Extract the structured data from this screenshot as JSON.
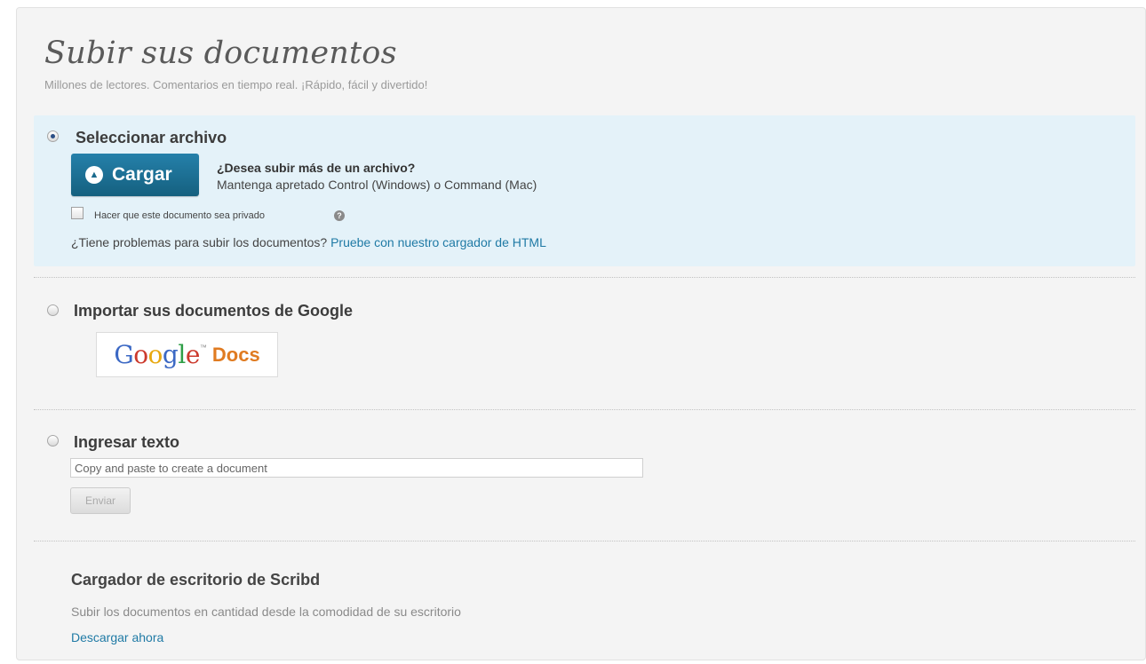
{
  "header": {
    "title": "Subir sus documentos",
    "subtitle": "Millones de lectores. Comentarios en tiempo real. ¡Rápido, fácil y divertido!"
  },
  "upload_file": {
    "heading": "Seleccionar archivo",
    "selected": true,
    "button_label": "Cargar",
    "button_icon": "arrow-up-circle-icon",
    "multi_question": "¿Desea subir más de un archivo?",
    "multi_hint": "Mantenga apretado Control (Windows) o Command (Mac)",
    "private_label": "Hacer que este documento sea privado",
    "private_checked": false,
    "trouble_text": "¿Tiene problemas para subir los documentos?",
    "trouble_link": "Pruebe con nuestro cargador de HTML"
  },
  "google_import": {
    "heading": "Importar sus documentos de Google",
    "selected": false,
    "logo_text": "Google",
    "logo_suffix": "Docs",
    "logo_tm": "™"
  },
  "enter_text": {
    "heading": "Ingresar texto",
    "selected": false,
    "placeholder": "Copy and paste to create a document",
    "value": "",
    "submit_label": "Enviar"
  },
  "desktop_uploader": {
    "title": "Cargador de escritorio de Scribd",
    "description": "Subir los documentos en cantidad desde la comodidad de su escritorio",
    "link": "Descargar ahora"
  },
  "colors": {
    "accent_blue": "#1f7aa5",
    "button_blue": "#15607f",
    "highlight_bg": "#e4f2f9",
    "google_blue": "#3b68c4",
    "google_red": "#cc3a2d",
    "google_yellow": "#e8a911",
    "google_green": "#2f9f47",
    "docs_orange": "#e07b21"
  }
}
